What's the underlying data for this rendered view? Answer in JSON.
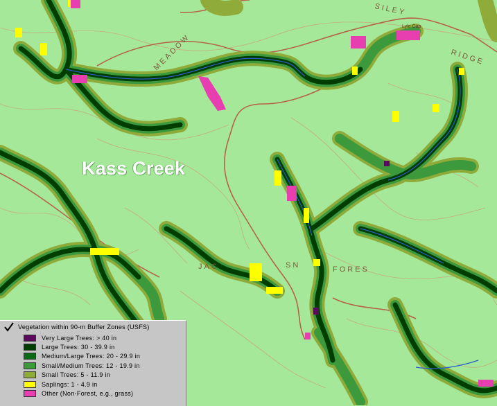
{
  "map": {
    "place_label": "Kass Creek",
    "base_color": "#a6e89a",
    "contour_color": "#c5a77f",
    "road_color": "#b4634a",
    "stream_color": "#2a5cc9",
    "topo_text": {
      "forest_label_1": "JAC",
      "forest_label_2": "SN",
      "forest_label_3": "FORES",
      "ridge_label": "MEADOW",
      "top_label": "SILEY",
      "top_right_label": "RIDGE",
      "small_label": "Lyle Cap"
    }
  },
  "legend": {
    "title": "Vegetation within 90-m Buffer Zones (USFS)",
    "checked": true,
    "items": [
      {
        "label": "Very Large Trees: > 40  in",
        "color": "#5a0a5e"
      },
      {
        "label": "Large Trees: 30 - 39.9 in",
        "color": "#003d00"
      },
      {
        "label": "Medium/Large Trees: 20 - 29.9 in",
        "color": "#0a6b14"
      },
      {
        "label": "Small/Medium Trees: 12 - 19.9 in",
        "color": "#3c9a3c"
      },
      {
        "label": "Small Trees: 5 - 11.9 in",
        "color": "#8fab3a"
      },
      {
        "label": "Saplings: 1 - 4.9 in",
        "color": "#ffff00"
      },
      {
        "label": "Other (Non-Forest, e.g., grass)",
        "color": "#e83fb0"
      }
    ]
  }
}
